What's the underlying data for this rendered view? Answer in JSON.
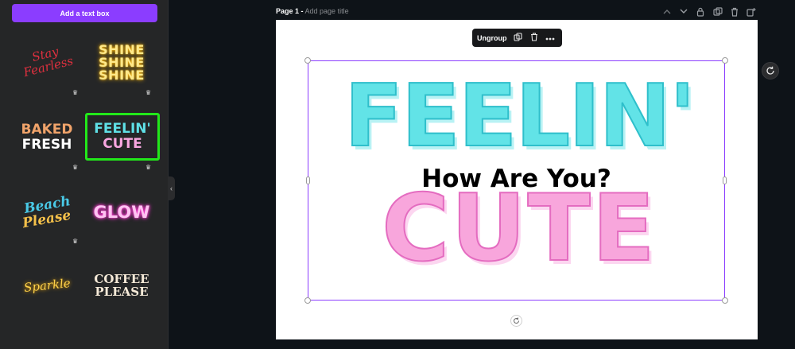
{
  "sidebar": {
    "add_text_label": "Add a text box",
    "tiles": {
      "stay_fearless": {
        "line1": "Stay",
        "line2": "Fearless"
      },
      "shine": {
        "line1": "SHINE",
        "line2": "SHINE",
        "line3": "SHINE"
      },
      "baked_fresh": {
        "line1": "BAKED",
        "line2": "FRESH"
      },
      "feelin_cute": {
        "line1": "FEELIN'",
        "line2": "CUTE"
      },
      "beach_please": {
        "line1": "Beach",
        "line2": "Please"
      },
      "glow": {
        "line1": "GLOW"
      },
      "sparkle": {
        "line1": "Sparkle"
      },
      "coffee_please": {
        "line1": "COFFEE",
        "line2": "PLEASE"
      }
    },
    "crown_glyph": "♛",
    "collapse_glyph": "‹"
  },
  "topbar": {
    "page_label": "Page 1 -",
    "page_title_placeholder": "Add page title",
    "icons": [
      "chevron-up-icon",
      "chevron-down-icon",
      "lock-icon",
      "duplicate-icon",
      "trash-icon",
      "add-page-icon"
    ]
  },
  "toolbar": {
    "ungroup_label": "Ungroup",
    "icons": [
      "copy-icon",
      "trash-icon",
      "more-icon"
    ]
  },
  "canvas": {
    "headline": "FEELIN'",
    "subheadline": "How Are You?",
    "bottom_word": "CUTE"
  },
  "colors": {
    "accent": "#8b3dff",
    "selected_border": "#22e81a",
    "feelin_cyan": "#62e3e7",
    "cute_pink": "#f8a6dc"
  }
}
